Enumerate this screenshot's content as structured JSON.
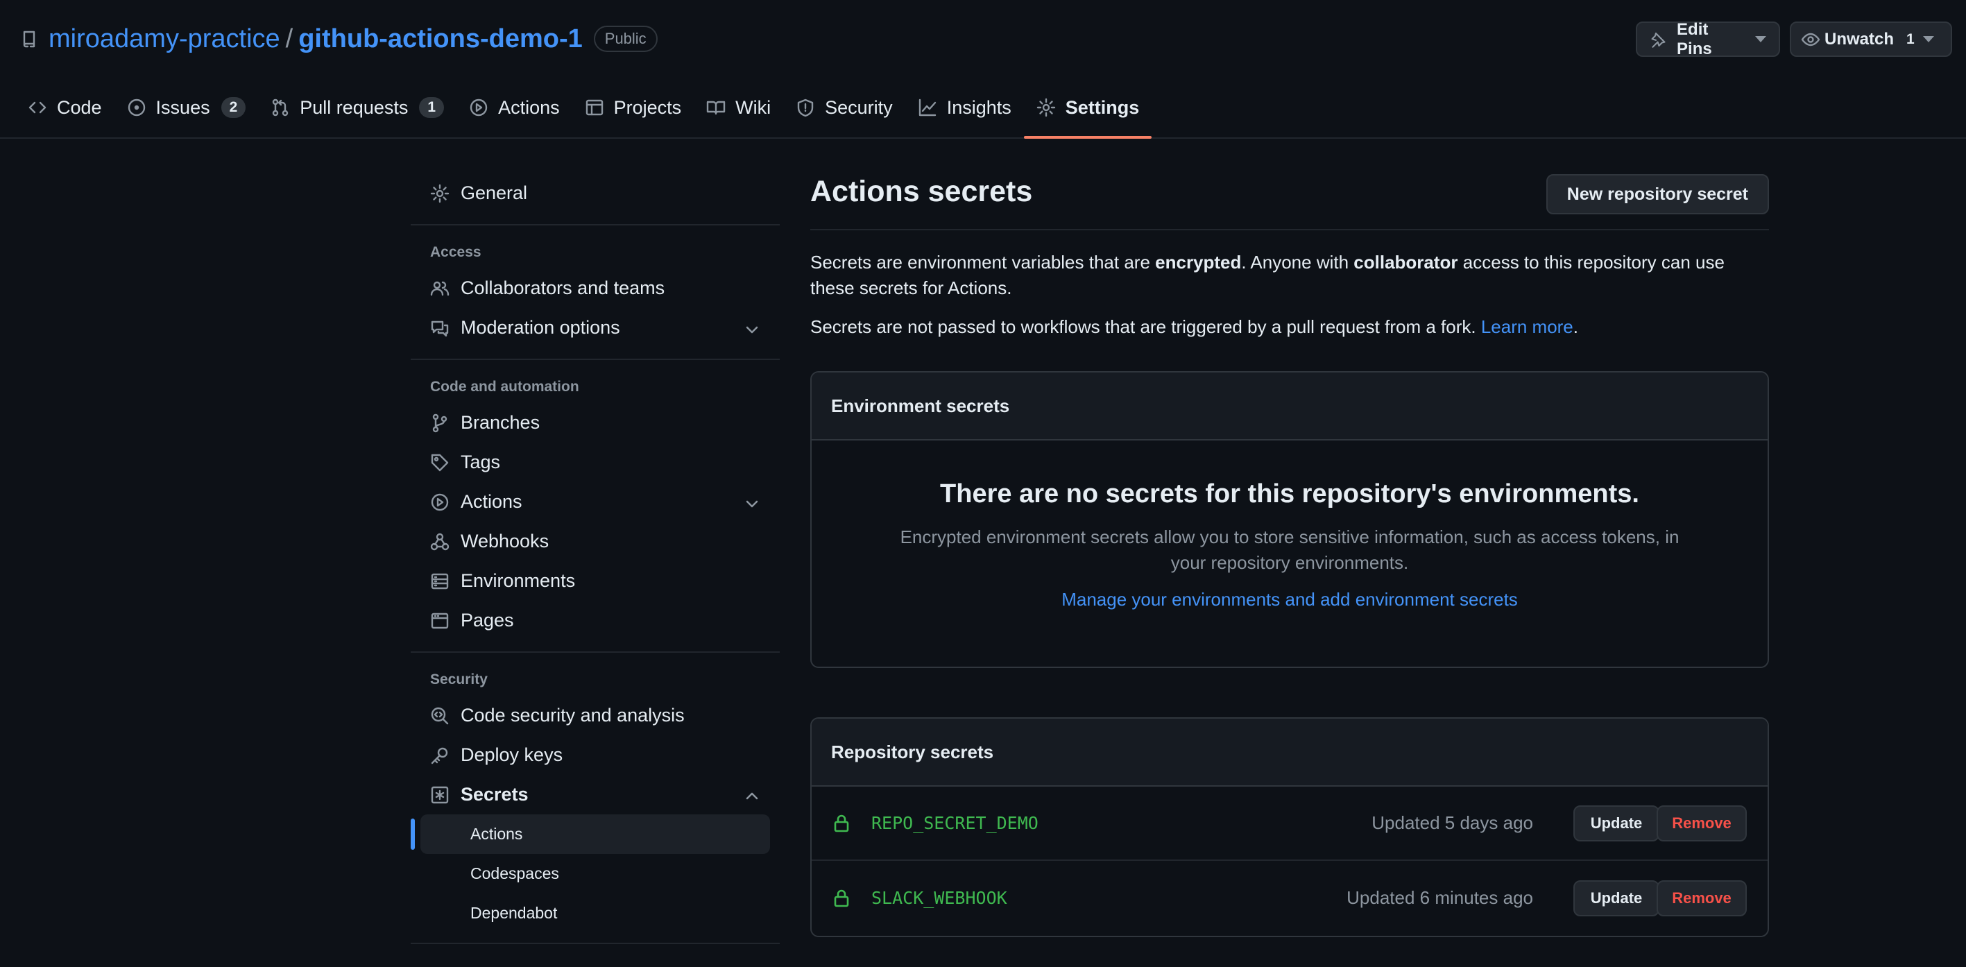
{
  "repo": {
    "owner": "miroadamy-practice",
    "separator": "/",
    "name": "github-actions-demo-1",
    "visibility": "Public"
  },
  "header_buttons": {
    "edit_pins": "Edit Pins",
    "unwatch": "Unwatch",
    "unwatch_count": "1"
  },
  "tabs": [
    {
      "label": "Code",
      "icon": "code-icon"
    },
    {
      "label": "Issues",
      "icon": "issue-icon",
      "count": "2"
    },
    {
      "label": "Pull requests",
      "icon": "pull-request-icon",
      "count": "1"
    },
    {
      "label": "Actions",
      "icon": "play-icon"
    },
    {
      "label": "Projects",
      "icon": "table-icon"
    },
    {
      "label": "Wiki",
      "icon": "book-icon"
    },
    {
      "label": "Security",
      "icon": "shield-icon"
    },
    {
      "label": "Insights",
      "icon": "graph-icon"
    },
    {
      "label": "Settings",
      "icon": "gear-icon",
      "active": true
    }
  ],
  "sidebar": {
    "general": "General",
    "access_heading": "Access",
    "collaborators": "Collaborators and teams",
    "moderation": "Moderation options",
    "code_heading": "Code and automation",
    "branches": "Branches",
    "tags": "Tags",
    "actions": "Actions",
    "webhooks": "Webhooks",
    "environments": "Environments",
    "pages": "Pages",
    "security_heading": "Security",
    "code_security": "Code security and analysis",
    "deploy_keys": "Deploy keys",
    "secrets": "Secrets",
    "secrets_sub": [
      "Actions",
      "Codespaces",
      "Dependabot"
    ]
  },
  "main": {
    "title": "Actions secrets",
    "new_secret_button": "New repository secret",
    "desc1_a": "Secrets are environment variables that are ",
    "desc1_b": "encrypted",
    "desc1_c": ". Anyone with ",
    "desc1_d": "collaborator",
    "desc1_e": " access to this repository can use these secrets for Actions.",
    "desc2_a": "Secrets are not passed to workflows that are triggered by a pull request from a fork. ",
    "desc2_link": "Learn more",
    "desc2_end": ".",
    "env_secrets": {
      "heading": "Environment secrets",
      "empty_title": "There are no secrets for this repository's environments.",
      "empty_desc": "Encrypted environment secrets allow you to store sensitive information, such as access tokens, in your repository environments.",
      "empty_link": "Manage your environments and add environment secrets"
    },
    "repo_secrets": {
      "heading": "Repository secrets",
      "update_label": "Update",
      "remove_label": "Remove",
      "items": [
        {
          "name": "REPO_SECRET_DEMO",
          "updated": "Updated 5 days ago"
        },
        {
          "name": "SLACK_WEBHOOK",
          "updated": "Updated 6 minutes ago"
        }
      ]
    }
  },
  "colors": {
    "background": "#0d1117",
    "link": "#4493f8",
    "secret_green": "#3fb950",
    "danger": "#f85149",
    "active_tab_underline": "#f78166"
  }
}
